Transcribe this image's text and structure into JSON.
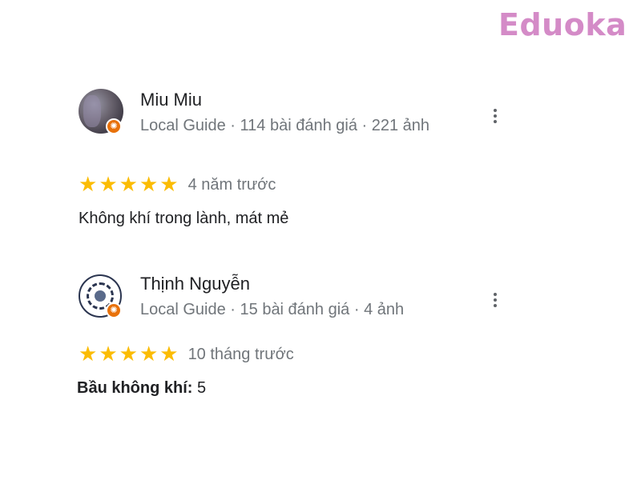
{
  "watermark": "Eduoka",
  "reviews": [
    {
      "name": "Miu Miu",
      "meta": "Local Guide · 114 bài đánh giá · 221 ảnh",
      "rating": 5,
      "stars": [
        "★",
        "★",
        "★",
        "★",
        "★"
      ],
      "date": "4 năm trước",
      "text": "Không khí trong lành, mát mẻ"
    },
    {
      "name": "Thịnh Nguyễn",
      "meta": "Local Guide · 15 bài đánh giá · 4 ảnh",
      "rating": 5,
      "stars": [
        "★",
        "★",
        "★",
        "★",
        "★"
      ],
      "date": "10 tháng trước",
      "attribute": {
        "label": "Bầu không khí:",
        "value": " 5"
      }
    }
  ],
  "icons": {
    "guide_badge": "✺",
    "more": "more-vertical-icon",
    "star": "star-icon"
  },
  "colors": {
    "star": "#fbbc04",
    "badge": "#e8710a",
    "watermark": "#d48bc7",
    "meta_text": "#70757a"
  }
}
